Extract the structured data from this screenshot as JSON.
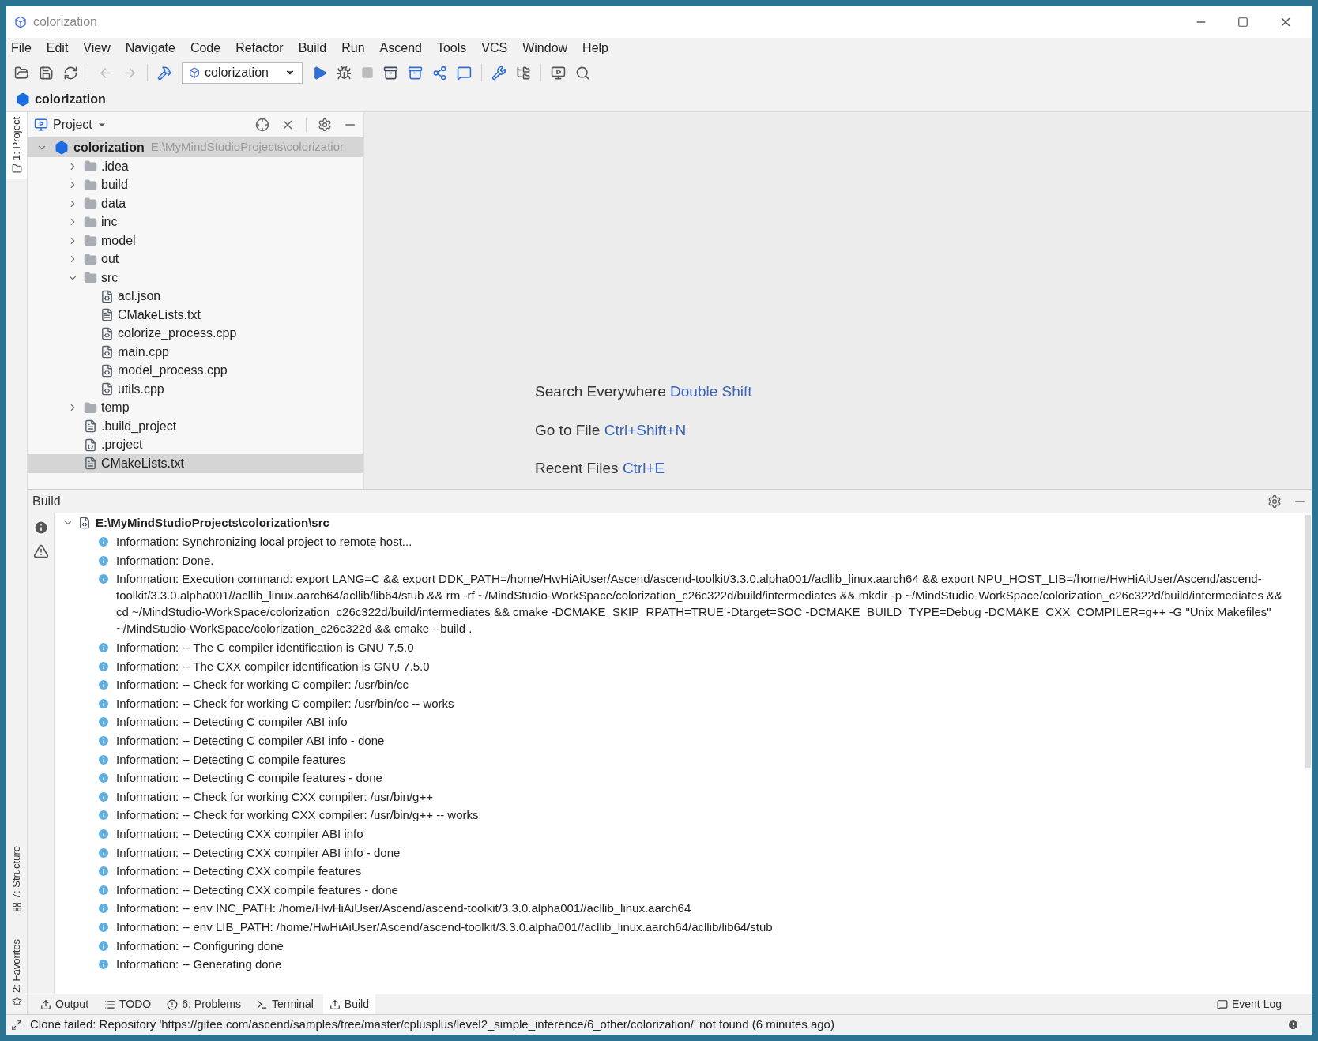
{
  "window": {
    "title": "colorization"
  },
  "menu": [
    "File",
    "Edit",
    "View",
    "Navigate",
    "Code",
    "Refactor",
    "Build",
    "Run",
    "Ascend",
    "Tools",
    "VCS",
    "Window",
    "Help"
  ],
  "toolbar": {
    "run_config": "colorization"
  },
  "breadcrumb": "colorization",
  "side_tabs": [
    {
      "label": "1: Project",
      "kind": "project",
      "selected": true
    },
    {
      "label": "7: Structure",
      "kind": "structure",
      "selected": false
    },
    {
      "label": "2: Favorites",
      "kind": "favorites",
      "selected": false
    }
  ],
  "project_panel": {
    "title": "Project",
    "tree": {
      "label": "colorization",
      "path": "E:\\MyMindStudioProjects\\colorizatior",
      "expanded": true,
      "selected": true,
      "children": [
        {
          "label": ".idea",
          "kind": "folder",
          "expanded": false,
          "selected": false
        },
        {
          "label": "build",
          "kind": "folder",
          "expanded": false,
          "selected": false
        },
        {
          "label": "data",
          "kind": "folder",
          "expanded": false,
          "selected": false
        },
        {
          "label": "inc",
          "kind": "folder",
          "expanded": false,
          "selected": false
        },
        {
          "label": "model",
          "kind": "folder",
          "expanded": false,
          "selected": false
        },
        {
          "label": "out",
          "kind": "folder",
          "expanded": false,
          "selected": false
        },
        {
          "label": "src",
          "kind": "folder",
          "expanded": true,
          "selected": false,
          "children": [
            {
              "label": "acl.json",
              "kind": "json",
              "selected": false
            },
            {
              "label": "CMakeLists.txt",
              "kind": "text",
              "selected": false
            },
            {
              "label": "colorize_process.cpp",
              "kind": "cpp",
              "selected": false
            },
            {
              "label": "main.cpp",
              "kind": "cpp",
              "selected": false
            },
            {
              "label": "model_process.cpp",
              "kind": "cpp",
              "selected": false
            },
            {
              "label": "utils.cpp",
              "kind": "cpp",
              "selected": false
            }
          ]
        },
        {
          "label": "temp",
          "kind": "folder",
          "expanded": false,
          "selected": false
        },
        {
          "label": ".build_project",
          "kind": "text",
          "selected": false
        },
        {
          "label": ".project",
          "kind": "json",
          "selected": false
        },
        {
          "label": "CMakeLists.txt",
          "kind": "text",
          "selected": true
        }
      ]
    }
  },
  "editor_hints": [
    {
      "label": "Search Everywhere",
      "shortcut": "Double Shift"
    },
    {
      "label": "Go to File",
      "shortcut": "Ctrl+Shift+N"
    },
    {
      "label": "Recent Files",
      "shortcut": "Ctrl+E"
    }
  ],
  "build": {
    "title": "Build",
    "root": {
      "path": "E:\\MyMindStudioProjects\\colorization\\src",
      "expanded": true
    },
    "lines": [
      "Information: Synchronizing local project to remote host...",
      "Information: Done.",
      "Information: Execution command: export LANG=C && export DDK_PATH=/home/HwHiAiUser/Ascend/ascend-toolkit/3.3.0.alpha001//acllib_linux.aarch64 && export NPU_HOST_LIB=/home/HwHiAiUser/Ascend/ascend-toolkit/3.3.0.alpha001//acllib_linux.aarch64/acllib/lib64/stub && rm -rf ~/MindStudio-WorkSpace/colorization_c26c322d/build/intermediates && mkdir -p ~/MindStudio-WorkSpace/colorization_c26c322d/build/intermediates && cd ~/MindStudio-WorkSpace/colorization_c26c322d/build/intermediates && cmake -DCMAKE_SKIP_RPATH=TRUE -Dtarget=SOC -DCMAKE_BUILD_TYPE=Debug -DCMAKE_CXX_COMPILER=g++ -G \"Unix Makefiles\" ~/MindStudio-WorkSpace/colorization_c26c322d && cmake --build .",
      "Information: -- The C compiler identification is GNU 7.5.0",
      "Information: -- The CXX compiler identification is GNU 7.5.0",
      "Information: -- Check for working C compiler: /usr/bin/cc",
      "Information: -- Check for working C compiler: /usr/bin/cc -- works",
      "Information: -- Detecting C compiler ABI info",
      "Information: -- Detecting C compiler ABI info - done",
      "Information: -- Detecting C compile features",
      "Information: -- Detecting C compile features - done",
      "Information: -- Check for working CXX compiler: /usr/bin/g++",
      "Information: -- Check for working CXX compiler: /usr/bin/g++ -- works",
      "Information: -- Detecting CXX compiler ABI info",
      "Information: -- Detecting CXX compiler ABI info - done",
      "Information: -- Detecting CXX compile features",
      "Information: -- Detecting CXX compile features - done",
      "Information: -- env INC_PATH: /home/HwHiAiUser/Ascend/ascend-toolkit/3.3.0.alpha001//acllib_linux.aarch64",
      "Information: -- env LIB_PATH: /home/HwHiAiUser/Ascend/ascend-toolkit/3.3.0.alpha001//acllib_linux.aarch64/acllib/lib64/stub",
      "Information: -- Configuring done",
      "Information: -- Generating done"
    ]
  },
  "bottom_tabs": [
    {
      "label": "Output",
      "kind": "output",
      "selected": false
    },
    {
      "label": "TODO",
      "kind": "todo",
      "selected": false
    },
    {
      "label": "6: Problems",
      "kind": "problems",
      "selected": false
    },
    {
      "label": "Terminal",
      "kind": "terminal",
      "selected": false
    },
    {
      "label": "Build",
      "kind": "build",
      "selected": true
    }
  ],
  "event_log": "Event Log",
  "status": "Clone failed: Repository 'https://gitee.com/ascend/samples/tree/master/cplusplus/level2_simple_inference/6_other/colorization/' not found (6 minutes ago)"
}
